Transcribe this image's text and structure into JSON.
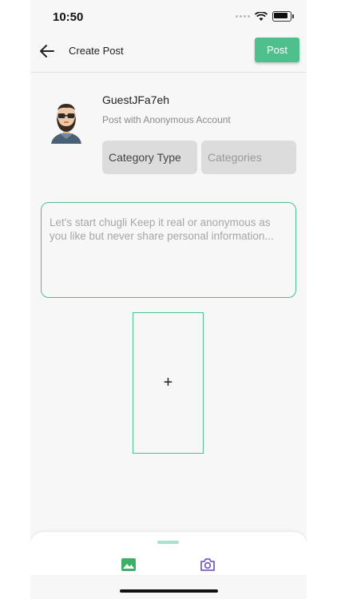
{
  "status_bar": {
    "time": "10:50"
  },
  "header": {
    "title": "Create Post",
    "post_label": "Post"
  },
  "user": {
    "name": "GuestJFa7eh",
    "subtitle": "Post with Anonymous Account"
  },
  "selectors": {
    "category_type": "Category Type",
    "categories": "Categories"
  },
  "composer": {
    "placeholder": "Let's start chugli Keep it real or anonymous as you like but never share personal information..."
  },
  "media": {
    "add_symbol": "+"
  },
  "colors": {
    "accent": "#4fc08d",
    "camera": "#7b5ec6"
  },
  "icons": [
    "back-arrow-icon",
    "gallery-icon",
    "camera-icon",
    "wifi-icon",
    "battery-icon"
  ]
}
